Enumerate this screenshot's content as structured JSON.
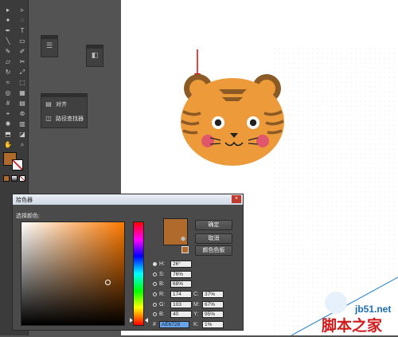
{
  "colors": {
    "fill": "#b06a2c",
    "selected": "#af6a2c",
    "artboard": "#ffffff",
    "workspace": "#535353"
  },
  "tools_panel": {
    "icons": [
      "selection-arrow-icon",
      "direct-select-icon",
      "magic-wand-icon",
      "lasso-icon",
      "pen-icon",
      "type-icon",
      "line-icon",
      "rectangle-icon",
      "paintbrush-icon",
      "pencil-icon",
      "eraser-icon",
      "scissors-icon",
      "rotate-icon",
      "scale-icon",
      "warp-icon",
      "free-transform-icon",
      "shape-builder-icon",
      "perspective-icon",
      "mesh-icon",
      "gradient-icon",
      "eyedropper-icon",
      "blend-icon",
      "symbol-sprayer-icon",
      "graph-icon",
      "artboard-icon",
      "slice-icon",
      "hand-icon",
      "zoom-icon"
    ]
  },
  "align_panel": {
    "items": [
      {
        "label": "对齐",
        "icon": "align-icon"
      },
      {
        "label": "路径查找器",
        "icon": "pathfinder-icon"
      }
    ]
  },
  "picker": {
    "title": "拾色器",
    "close_label": "×",
    "choose_label": "选择颜色:",
    "buttons": {
      "ok": "确定",
      "cancel": "取消",
      "swatches": "颜色色板"
    },
    "hsb": [
      {
        "label": "H:",
        "value": "26°",
        "checked": true
      },
      {
        "label": "S:",
        "value": "76%",
        "checked": false
      },
      {
        "label": "B:",
        "value": "68%",
        "checked": false
      }
    ],
    "rgb": [
      {
        "label": "R:",
        "value": "174"
      },
      {
        "label": "G:",
        "value": "103"
      },
      {
        "label": "B:",
        "value": "40"
      }
    ],
    "cmyk": [
      {
        "label": "C:",
        "value": "37%"
      },
      {
        "label": "M:",
        "value": "67%"
      },
      {
        "label": "Y:",
        "value": "95%"
      },
      {
        "label": "K:",
        "value": "1%"
      }
    ],
    "hex": {
      "label": "#",
      "value": "AE6728"
    }
  },
  "watermark": {
    "site": "jb51.net",
    "text": "脚本之家"
  }
}
